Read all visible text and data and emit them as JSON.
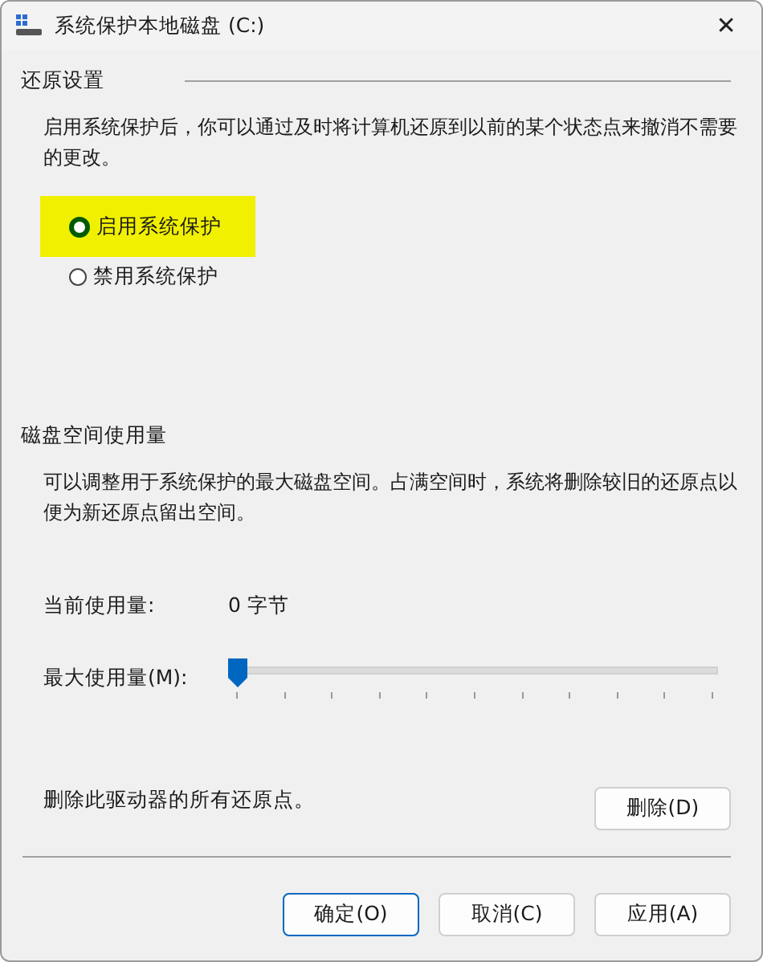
{
  "window": {
    "title": "系统保护本地磁盘 (C:)",
    "close": "✕"
  },
  "restore_settings": {
    "heading": "还原设置",
    "description": "启用系统保护后，你可以通过及时将计算机还原到以前的某个状态点来撤消不需要的更改。",
    "options": [
      {
        "label": "启用系统保护",
        "selected": true,
        "highlighted": true
      },
      {
        "label": "禁用系统保护",
        "selected": false,
        "highlighted": false
      }
    ]
  },
  "disk_usage": {
    "heading": "磁盘空间使用量",
    "description": "可以调整用于系统保护的最大磁盘空间。占满空间时，系统将删除较旧的还原点以便为新还原点留出空间。",
    "current_label": "当前使用量:",
    "current_value": "0 字节",
    "max_label": "最大使用量(M):",
    "max_slider": {
      "level": 0
    },
    "delete_text": "删除此驱动器的所有还原点。",
    "delete_button": "删除(D)"
  },
  "buttons": [
    {
      "label": "确定(O)",
      "default": true
    },
    {
      "label": "取消(C)",
      "default": false
    },
    {
      "label": "应用(A)",
      "default": false
    }
  ]
}
